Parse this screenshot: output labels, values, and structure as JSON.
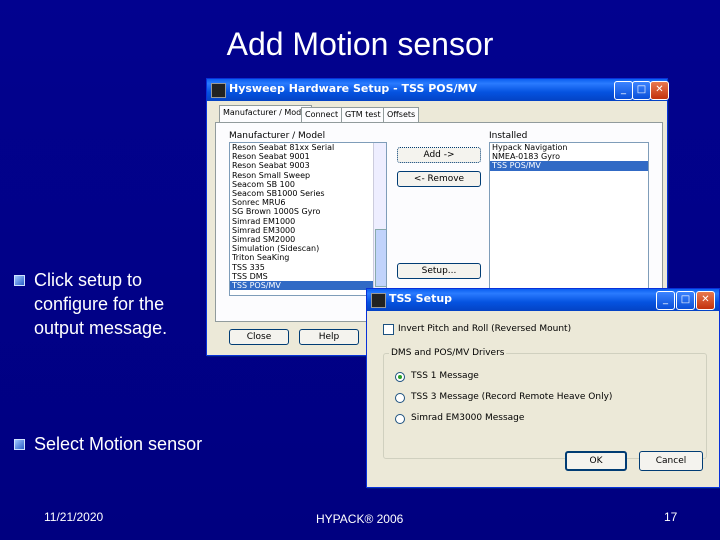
{
  "slide": {
    "title": "Add Motion sensor",
    "bullets": [
      "Click setup to configure for the output message.",
      "Select Motion sensor"
    ],
    "footer": {
      "date": "11/21/2020",
      "center": "HYPACK® 2006",
      "page": "17"
    }
  },
  "hw_window": {
    "title": "Hysweep Hardware Setup - TSS POS/MV",
    "controls": {
      "minimize": "_",
      "maximize": "□",
      "close": "✕"
    },
    "tabs": [
      "Manufacturer / Model",
      "Connect",
      "GTM test",
      "Offsets"
    ],
    "left_label": "Manufacturer / Model",
    "right_label": "Installed",
    "models": [
      "Reson Seabat 81xx Serial",
      "Reson Seabat 9001",
      "Reson Seabat 9003",
      "Reson Small Sweep",
      "Seacom SB 100",
      "Seacom SB1000 Series",
      "Sonrec MRU6",
      "SG Brown 1000S Gyro",
      "Simrad EM1000",
      "Simrad EM3000",
      "Simrad SM2000",
      "Simulation (Sidescan)",
      "Triton SeaKing",
      "TSS 335",
      "TSS DMS",
      "TSS POS/MV"
    ],
    "selected_model": "TSS POS/MV",
    "installed": [
      "Hypack Navigation",
      "NMEA-0183 Gyro",
      "TSS POS/MV"
    ],
    "selected_installed": "TSS POS/MV",
    "buttons": {
      "add": "Add ->",
      "remove": "<- Remove",
      "setup": "Setup...",
      "close": "Close",
      "help": "Help"
    }
  },
  "tss_window": {
    "title": "TSS Setup",
    "controls": {
      "minimize": "_",
      "maximize": "□",
      "close": "✕"
    },
    "invert_label": "Invert Pitch and Roll (Reversed Mount)",
    "invert_checked": false,
    "group_label": "DMS and POS/MV Drivers",
    "options": [
      "TSS 1 Message",
      "TSS 3 Message (Record Remote Heave Only)",
      "Simrad EM3000 Message"
    ],
    "selected_option": "TSS 1 Message",
    "buttons": {
      "ok": "OK",
      "cancel": "Cancel"
    }
  }
}
